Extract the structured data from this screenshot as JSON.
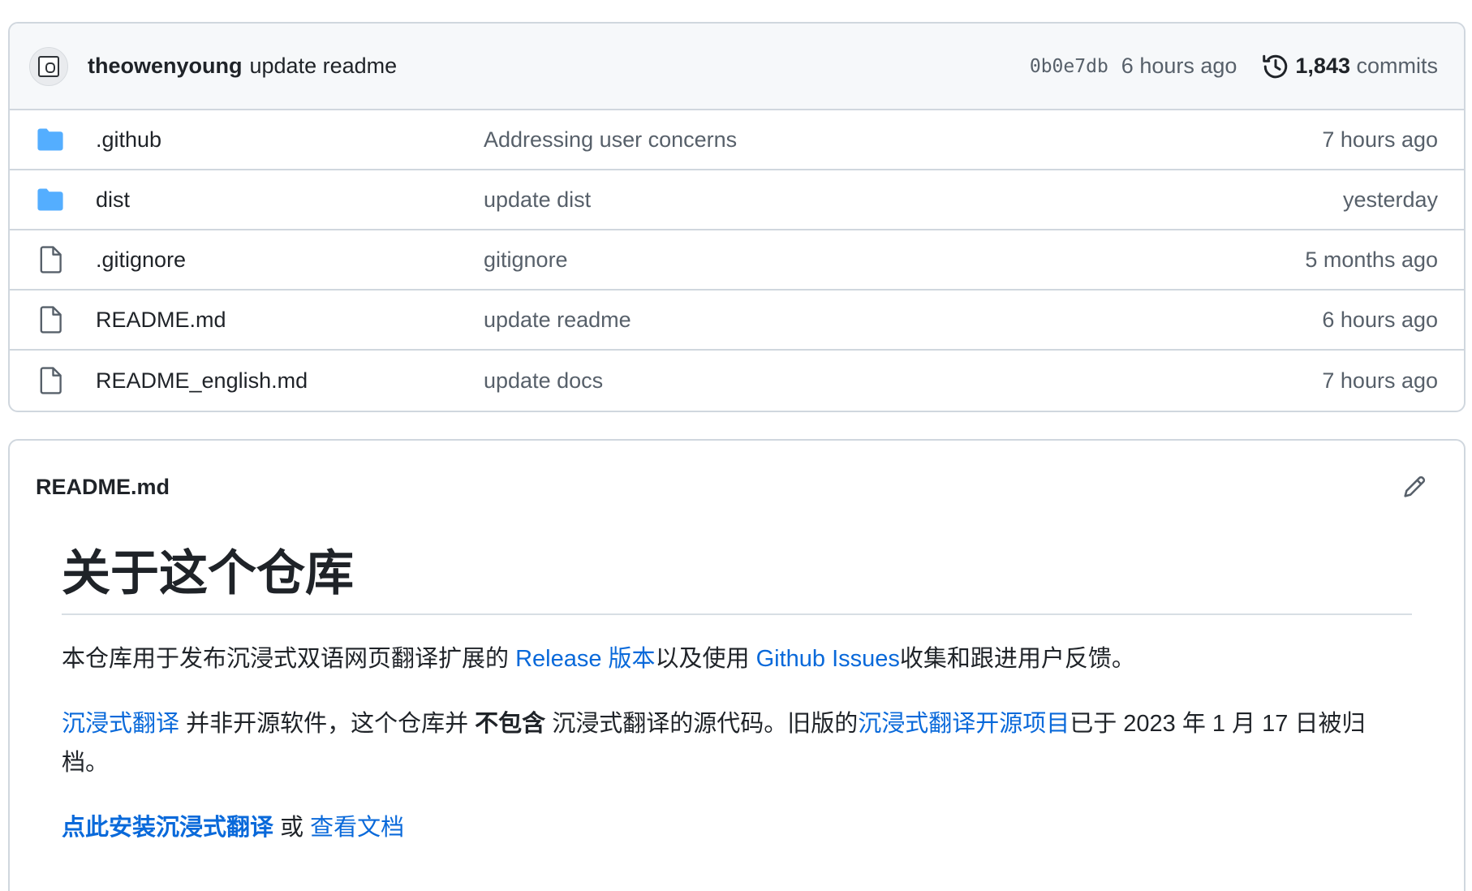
{
  "commit": {
    "author": "theowenyoung",
    "message": "update readme",
    "sha": "0b0e7db",
    "time": "6 hours ago",
    "count": "1,843",
    "count_label": "commits"
  },
  "files": [
    {
      "name": ".github",
      "type": "folder",
      "commit": "Addressing user concerns",
      "time": "7 hours ago"
    },
    {
      "name": "dist",
      "type": "folder",
      "commit": "update dist",
      "time": "yesterday"
    },
    {
      "name": ".gitignore",
      "type": "file",
      "commit": "gitignore",
      "time": "5 months ago"
    },
    {
      "name": "README.md",
      "type": "file",
      "commit": "update readme",
      "time": "6 hours ago"
    },
    {
      "name": "README_english.md",
      "type": "file",
      "commit": "update docs",
      "time": "7 hours ago"
    }
  ],
  "readme": {
    "filename": "README.md",
    "heading": "关于这个仓库",
    "p1": {
      "t1": "本仓库用于发布沉浸式双语网页翻译扩展的 ",
      "link1": "Release 版本",
      "t2": "以及使用 ",
      "link2": "Github Issues",
      "t3": "收集和跟进用户反馈。"
    },
    "p2": {
      "link1": "沉浸式翻译",
      "t1": " 并非开源软件，这个仓库并 ",
      "strong": "不包含",
      "t2": " 沉浸式翻译的源代码。旧版的",
      "link2": "沉浸式翻译开源项目",
      "t3": "已于 2023 年 1 月 17 日被归档。"
    },
    "p3": {
      "link1": "点此安装沉浸式翻译",
      "t1": " 或 ",
      "link2": "查看文档"
    }
  },
  "colors": {
    "link": "#0969da",
    "folder": "#54aeff",
    "muted": "#57606a",
    "border": "#d0d7de"
  },
  "icons": {
    "folder": "folder-icon",
    "file": "file-icon",
    "history": "history-icon",
    "edit": "pencil-icon"
  }
}
